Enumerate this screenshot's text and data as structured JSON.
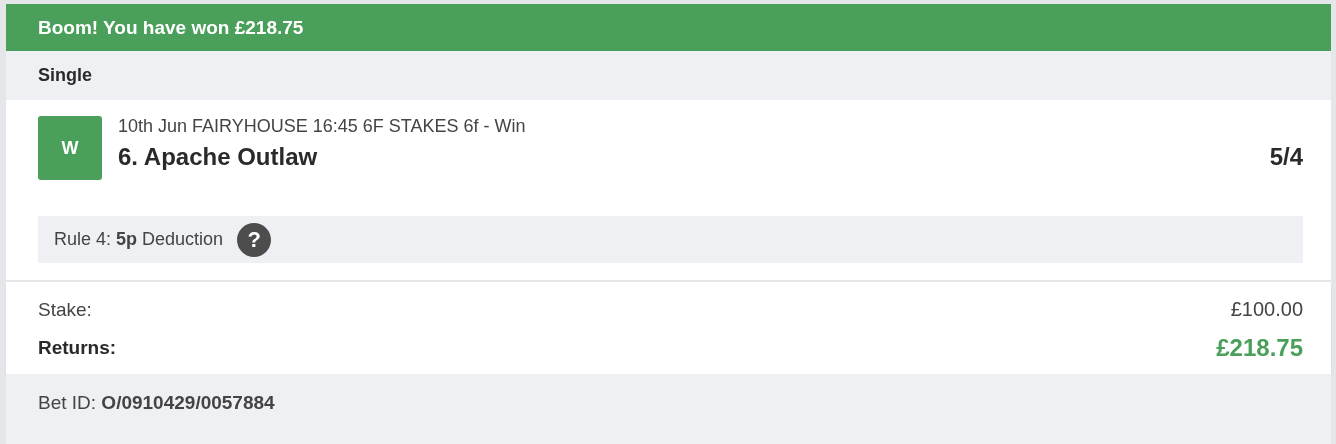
{
  "banner": {
    "text": "Boom! You have won £218.75"
  },
  "bet_type": "Single",
  "selection": {
    "badge": "W",
    "event": "10th Jun FAIRYHOUSE 16:45 6F STAKES 6f - Win",
    "runner": "6. Apache Outlaw",
    "odds": "5/4"
  },
  "rule4": {
    "text": "Rule 4: **5p** Deduction",
    "help": "?"
  },
  "summary": [
    {
      "label": "Stake:",
      "value": "£100.00",
      "kind": "plain"
    },
    {
      "label": "Returns:",
      "value": "£218.75",
      "kind": "total"
    }
  ],
  "bet_id": "Bet ID: **O/0910429/0057884**"
}
